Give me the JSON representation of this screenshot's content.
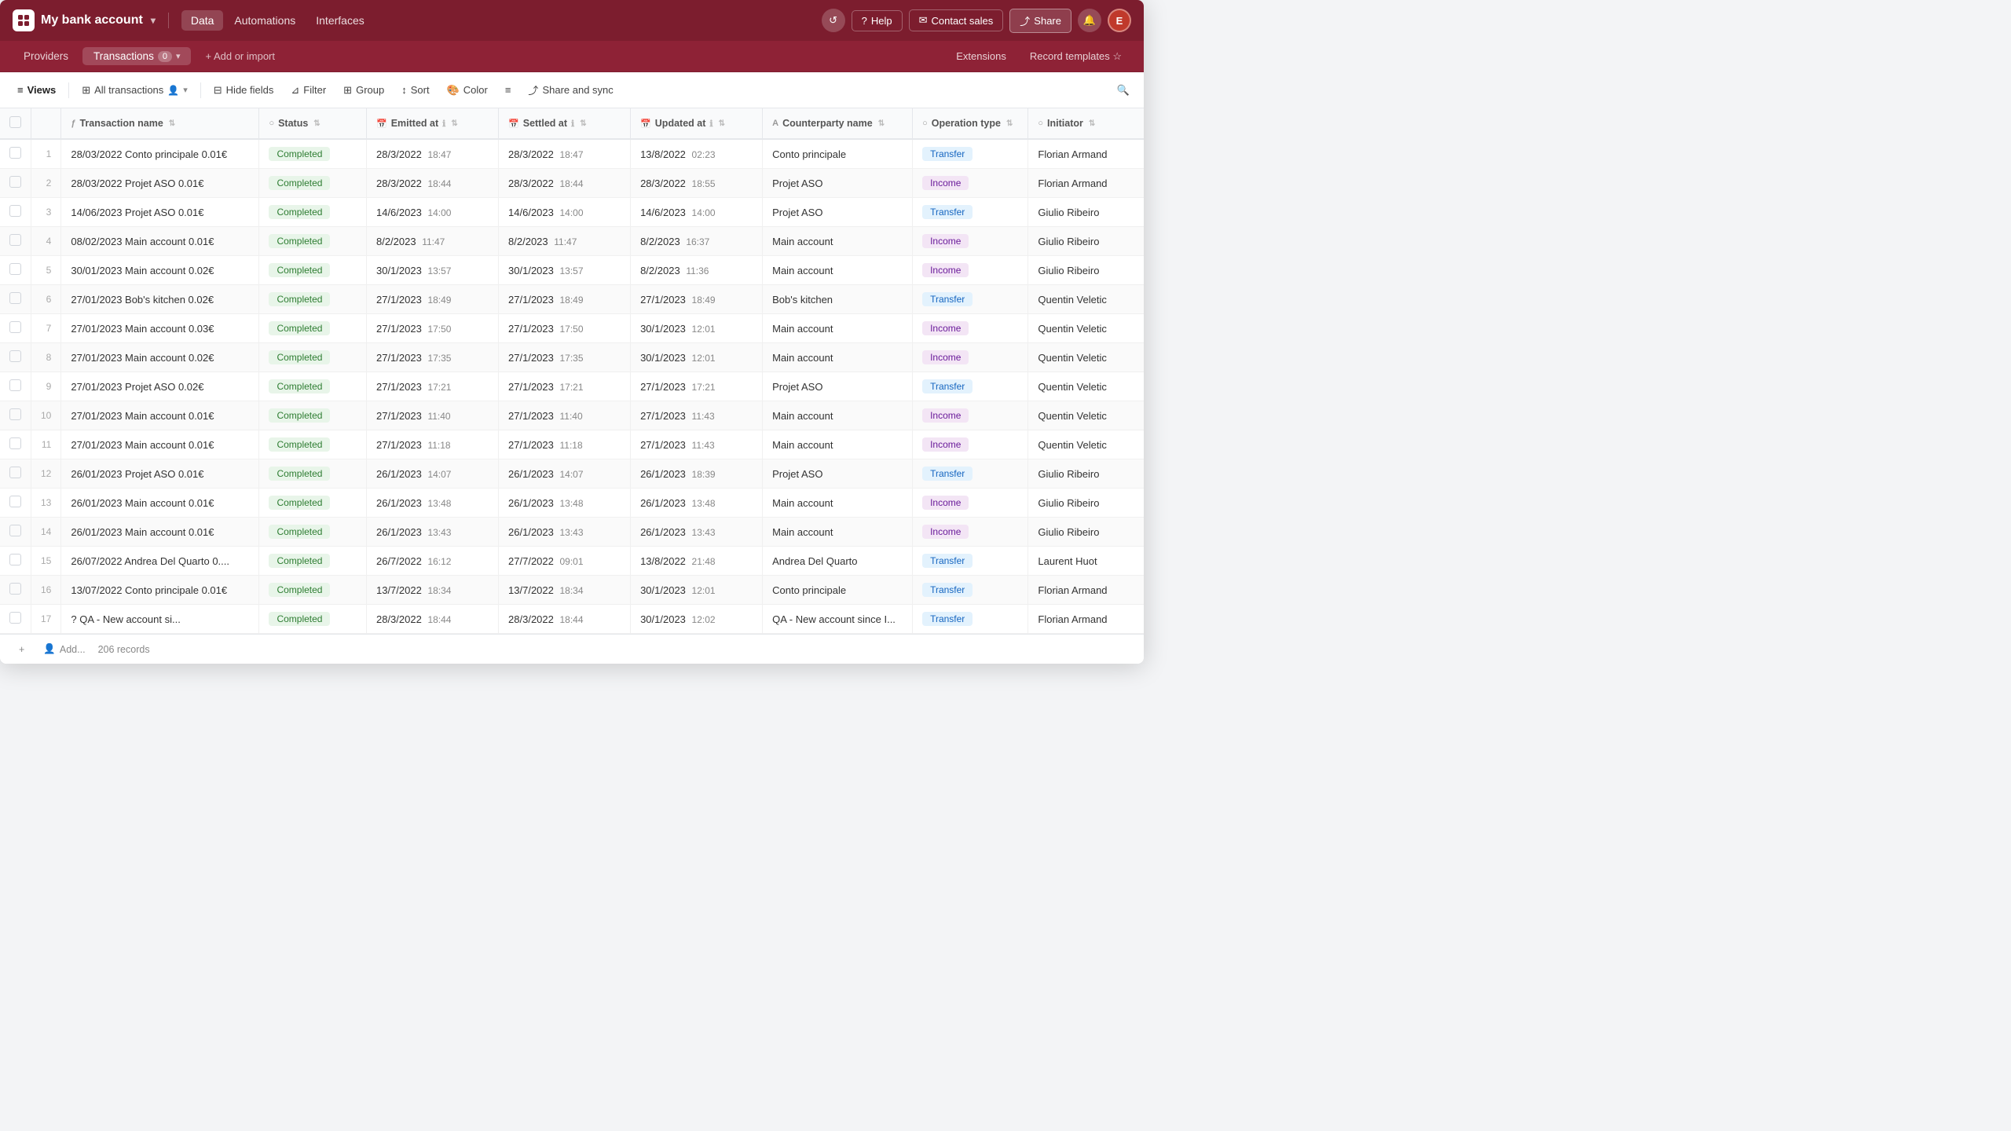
{
  "topbar": {
    "title": "My bank account",
    "chevron": "▾",
    "nav": [
      {
        "label": "Data",
        "active": true
      },
      {
        "label": "Automations",
        "active": false
      },
      {
        "label": "Interfaces",
        "active": false
      }
    ],
    "right": {
      "history_icon": "↺",
      "help_label": "Help",
      "contact_label": "Contact sales",
      "share_label": "Share",
      "bell_icon": "🔔",
      "avatar_label": "E"
    }
  },
  "subnav": {
    "providers_label": "Providers",
    "transactions_label": "Transactions",
    "transactions_badge": "0",
    "add_import_label": "+ Add or import",
    "right": {
      "extensions_label": "Extensions",
      "record_templates_label": "Record templates ☆"
    }
  },
  "toolbar": {
    "views_label": "Views",
    "view_icon": "⊞",
    "all_transactions_label": "All transactions",
    "filter_icon": "⊞",
    "view_options_icon": "▾",
    "hide_fields_label": "Hide fields",
    "filter_label": "Filter",
    "group_label": "Group",
    "sort_label": "Sort",
    "color_label": "Color",
    "density_icon": "≡",
    "share_sync_label": "Share and sync"
  },
  "table": {
    "columns": [
      {
        "id": "tx_name",
        "label": "Transaction name",
        "icon": "ƒ"
      },
      {
        "id": "status",
        "label": "Status",
        "icon": "○"
      },
      {
        "id": "emitted_at",
        "label": "Emitted at",
        "icon": "📅"
      },
      {
        "id": "settled_at",
        "label": "Settled at",
        "icon": "📅"
      },
      {
        "id": "updated_at",
        "label": "Updated at",
        "icon": "📅"
      },
      {
        "id": "counterparty",
        "label": "Counterparty name",
        "icon": "A"
      },
      {
        "id": "op_type",
        "label": "Operation type",
        "icon": "○"
      },
      {
        "id": "initiator",
        "label": "Initiator",
        "icon": "○"
      }
    ],
    "rows": [
      {
        "num": 1,
        "tx": "28/03/2022 Conto principale 0.01€",
        "status": "Completed",
        "emitted_date": "28/3/2022",
        "emitted_time": "18:47",
        "settled_date": "28/3/2022",
        "settled_time": "18:47",
        "updated_date": "13/8/2022",
        "updated_time": "02:23",
        "counterparty": "Conto principale",
        "op_type": "Transfer",
        "op_class": "transfer",
        "initiator": "Florian Armand"
      },
      {
        "num": 2,
        "tx": "28/03/2022 Projet ASO 0.01€",
        "status": "Completed",
        "emitted_date": "28/3/2022",
        "emitted_time": "18:44",
        "settled_date": "28/3/2022",
        "settled_time": "18:44",
        "updated_date": "28/3/2022",
        "updated_time": "18:55",
        "counterparty": "Projet ASO",
        "op_type": "Income",
        "op_class": "income",
        "initiator": "Florian Armand"
      },
      {
        "num": 3,
        "tx": "14/06/2023 Projet ASO 0.01€",
        "status": "Completed",
        "emitted_date": "14/6/2023",
        "emitted_time": "14:00",
        "settled_date": "14/6/2023",
        "settled_time": "14:00",
        "updated_date": "14/6/2023",
        "updated_time": "14:00",
        "counterparty": "Projet ASO",
        "op_type": "Transfer",
        "op_class": "transfer",
        "initiator": "Giulio Ribeiro"
      },
      {
        "num": 4,
        "tx": "08/02/2023 Main account 0.01€",
        "status": "Completed",
        "emitted_date": "8/2/2023",
        "emitted_time": "11:47",
        "settled_date": "8/2/2023",
        "settled_time": "11:47",
        "updated_date": "8/2/2023",
        "updated_time": "16:37",
        "counterparty": "Main account",
        "op_type": "Income",
        "op_class": "income",
        "initiator": "Giulio Ribeiro"
      },
      {
        "num": 5,
        "tx": "30/01/2023 Main account 0.02€",
        "status": "Completed",
        "emitted_date": "30/1/2023",
        "emitted_time": "13:57",
        "settled_date": "30/1/2023",
        "settled_time": "13:57",
        "updated_date": "8/2/2023",
        "updated_time": "11:36",
        "counterparty": "Main account",
        "op_type": "Income",
        "op_class": "income",
        "initiator": "Giulio Ribeiro"
      },
      {
        "num": 6,
        "tx": "27/01/2023 Bob's kitchen 0.02€",
        "status": "Completed",
        "emitted_date": "27/1/2023",
        "emitted_time": "18:49",
        "settled_date": "27/1/2023",
        "settled_time": "18:49",
        "updated_date": "27/1/2023",
        "updated_time": "18:49",
        "counterparty": "Bob's kitchen",
        "op_type": "Transfer",
        "op_class": "transfer",
        "initiator": "Quentin Veletic"
      },
      {
        "num": 7,
        "tx": "27/01/2023 Main account 0.03€",
        "status": "Completed",
        "emitted_date": "27/1/2023",
        "emitted_time": "17:50",
        "settled_date": "27/1/2023",
        "settled_time": "17:50",
        "updated_date": "30/1/2023",
        "updated_time": "12:01",
        "counterparty": "Main account",
        "op_type": "Income",
        "op_class": "income",
        "initiator": "Quentin Veletic"
      },
      {
        "num": 8,
        "tx": "27/01/2023 Main account 0.02€",
        "status": "Completed",
        "emitted_date": "27/1/2023",
        "emitted_time": "17:35",
        "settled_date": "27/1/2023",
        "settled_time": "17:35",
        "updated_date": "30/1/2023",
        "updated_time": "12:01",
        "counterparty": "Main account",
        "op_type": "Income",
        "op_class": "income",
        "initiator": "Quentin Veletic"
      },
      {
        "num": 9,
        "tx": "27/01/2023 Projet ASO 0.02€",
        "status": "Completed",
        "emitted_date": "27/1/2023",
        "emitted_time": "17:21",
        "settled_date": "27/1/2023",
        "settled_time": "17:21",
        "updated_date": "27/1/2023",
        "updated_time": "17:21",
        "counterparty": "Projet ASO",
        "op_type": "Transfer",
        "op_class": "transfer",
        "initiator": "Quentin Veletic"
      },
      {
        "num": 10,
        "tx": "27/01/2023 Main account 0.01€",
        "status": "Completed",
        "emitted_date": "27/1/2023",
        "emitted_time": "11:40",
        "settled_date": "27/1/2023",
        "settled_time": "11:40",
        "updated_date": "27/1/2023",
        "updated_time": "11:43",
        "counterparty": "Main account",
        "op_type": "Income",
        "op_class": "income",
        "initiator": "Quentin Veletic"
      },
      {
        "num": 11,
        "tx": "27/01/2023 Main account 0.01€",
        "status": "Completed",
        "emitted_date": "27/1/2023",
        "emitted_time": "11:18",
        "settled_date": "27/1/2023",
        "settled_time": "11:18",
        "updated_date": "27/1/2023",
        "updated_time": "11:43",
        "counterparty": "Main account",
        "op_type": "Income",
        "op_class": "income",
        "initiator": "Quentin Veletic"
      },
      {
        "num": 12,
        "tx": "26/01/2023 Projet ASO 0.01€",
        "status": "Completed",
        "emitted_date": "26/1/2023",
        "emitted_time": "14:07",
        "settled_date": "26/1/2023",
        "settled_time": "14:07",
        "updated_date": "26/1/2023",
        "updated_time": "18:39",
        "counterparty": "Projet ASO",
        "op_type": "Transfer",
        "op_class": "transfer",
        "initiator": "Giulio Ribeiro"
      },
      {
        "num": 13,
        "tx": "26/01/2023 Main account 0.01€",
        "status": "Completed",
        "emitted_date": "26/1/2023",
        "emitted_time": "13:48",
        "settled_date": "26/1/2023",
        "settled_time": "13:48",
        "updated_date": "26/1/2023",
        "updated_time": "13:48",
        "counterparty": "Main account",
        "op_type": "Income",
        "op_class": "income",
        "initiator": "Giulio Ribeiro"
      },
      {
        "num": 14,
        "tx": "26/01/2023 Main account 0.01€",
        "status": "Completed",
        "emitted_date": "26/1/2023",
        "emitted_time": "13:43",
        "settled_date": "26/1/2023",
        "settled_time": "13:43",
        "updated_date": "26/1/2023",
        "updated_time": "13:43",
        "counterparty": "Main account",
        "op_type": "Income",
        "op_class": "income",
        "initiator": "Giulio Ribeiro"
      },
      {
        "num": 15,
        "tx": "26/07/2022 Andrea Del Quarto 0....",
        "status": "Completed",
        "emitted_date": "26/7/2022",
        "emitted_time": "16:12",
        "settled_date": "27/7/2022",
        "settled_time": "09:01",
        "updated_date": "13/8/2022",
        "updated_time": "21:48",
        "counterparty": "Andrea Del Quarto",
        "op_type": "Transfer",
        "op_class": "transfer",
        "initiator": "Laurent Huot"
      },
      {
        "num": 16,
        "tx": "13/07/2022 Conto principale 0.01€",
        "status": "Completed",
        "emitted_date": "13/7/2022",
        "emitted_time": "18:34",
        "settled_date": "13/7/2022",
        "settled_time": "18:34",
        "updated_date": "30/1/2023",
        "updated_time": "12:01",
        "counterparty": "Conto principale",
        "op_type": "Transfer",
        "op_class": "transfer",
        "initiator": "Florian Armand"
      },
      {
        "num": 17,
        "tx": "? QA - New account si...",
        "status": "Completed",
        "emitted_date": "28/3/2022",
        "emitted_time": "18:44",
        "settled_date": "28/3/2022",
        "settled_time": "18:44",
        "updated_date": "30/1/2023",
        "updated_time": "12:02",
        "counterparty": "QA - New account since I...",
        "op_type": "Transfer",
        "op_class": "transfer",
        "initiator": "Florian Armand"
      }
    ],
    "footer": {
      "records_count": "206 records",
      "add_label": "+ Add...",
      "add_icon": "+"
    }
  }
}
